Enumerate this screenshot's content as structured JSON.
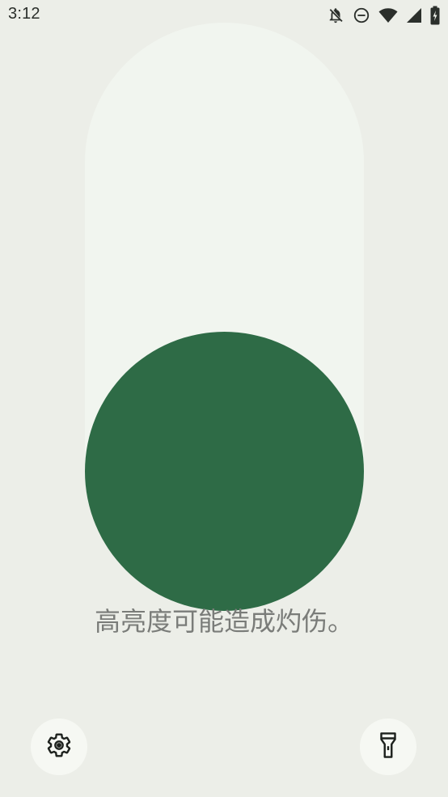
{
  "status_bar": {
    "time": "3:12",
    "icons": [
      "notifications-off-icon",
      "do-not-disturb-icon",
      "wifi-icon",
      "cellular-signal-icon",
      "battery-icon"
    ]
  },
  "brightness_slider": {
    "level": 0.0
  },
  "warning_text": "高亮度可能造成灼伤。",
  "buttons": {
    "settings_icon": "gear-icon",
    "flashlight_icon": "flashlight-icon"
  },
  "colors": {
    "background": "#ECEEE8",
    "track": "#F1F5EF",
    "thumb": "#2E6B46",
    "button_bg": "#F6F8F3"
  }
}
